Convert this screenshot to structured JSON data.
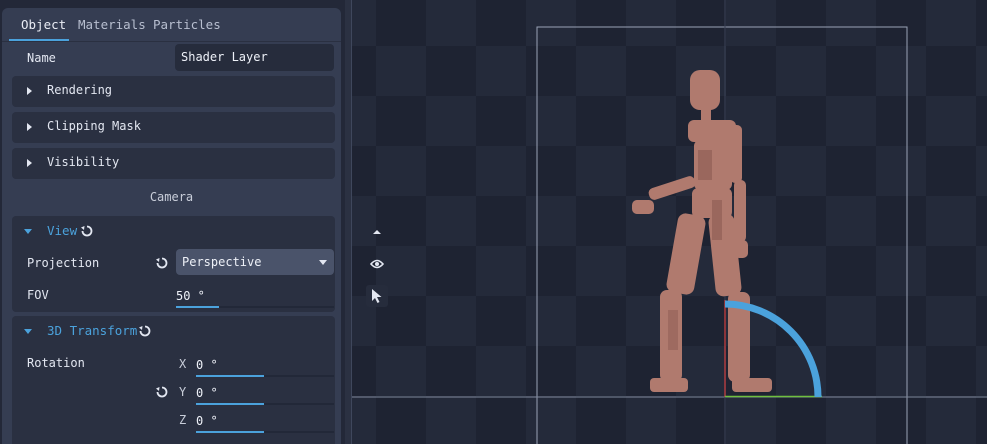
{
  "tabs": [
    {
      "label": "Object",
      "active": true
    },
    {
      "label": "Materials",
      "active": false
    },
    {
      "label": "Particles",
      "active": false
    }
  ],
  "name_row": {
    "label": "Name",
    "value": "Shader Layer"
  },
  "sections": [
    {
      "label": "Rendering"
    },
    {
      "label": "Clipping Mask"
    },
    {
      "label": "Visibility"
    }
  ],
  "camera": {
    "title": "Camera",
    "view": {
      "label": "View",
      "projection_label": "Projection",
      "projection_value": "Perspective",
      "fov_label": "FOV",
      "fov_value": "50 °"
    }
  },
  "transform": {
    "label": "3D Transform",
    "rotation_label": "Rotation",
    "axes": [
      {
        "axis": "X",
        "value": "0 °"
      },
      {
        "axis": "Y",
        "value": "0 °"
      },
      {
        "axis": "Z",
        "value": "0 °"
      }
    ]
  },
  "viewport": {
    "tools": [
      "up-arrow-icon",
      "eye-icon",
      "cursor-icon"
    ],
    "colors": {
      "accent": "#4ba2dc",
      "figure": "#b07a6e",
      "x_axis": "#d04040",
      "y_axis": "#6fbf3f"
    }
  }
}
